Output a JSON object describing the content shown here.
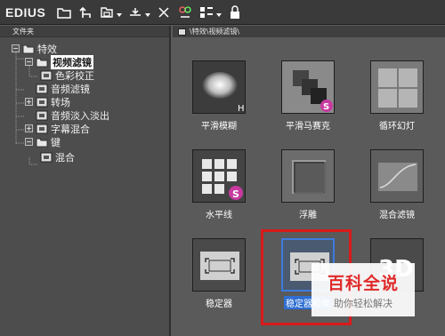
{
  "app": {
    "title": "EDIUS"
  },
  "toolbar": {
    "icons": [
      "folder-icon",
      "up-arrow-icon",
      "copy-folder-icon",
      "import-icon",
      "delete-icon",
      "properties-icon",
      "view-mode-icon",
      "lock-icon"
    ]
  },
  "left_pane": {
    "header": "文件夹",
    "tree": [
      {
        "label": "特效",
        "expander": "−",
        "icon": "folder-icon"
      },
      {
        "label": "视频滤镜",
        "expander": "−",
        "icon": "folder-icon",
        "selected": true
      },
      {
        "label": "色彩校正",
        "icon": "fx-icon"
      },
      {
        "label": "音频滤镜",
        "icon": "fx-icon"
      },
      {
        "label": "转场",
        "expander": "+",
        "icon": "fx-icon"
      },
      {
        "label": "音频淡入淡出",
        "icon": "fx-icon"
      },
      {
        "label": "字幕混合",
        "expander": "+",
        "icon": "fx-icon"
      },
      {
        "label": "键",
        "expander": "−",
        "icon": "folder-icon"
      },
      {
        "label": "混合",
        "icon": "fx-icon"
      }
    ]
  },
  "right_pane": {
    "path": "\\特效\\视频滤镜\\",
    "effects": [
      {
        "label": "平滑模糊",
        "icon": "smooth-blur-icon"
      },
      {
        "label": "平滑马赛克",
        "icon": "smooth-mosaic-icon"
      },
      {
        "label": "循环幻灯",
        "icon": "loop-slide-icon"
      },
      {
        "label": "水平线",
        "icon": "horizontal-lines-icon"
      },
      {
        "label": "浮雕",
        "icon": "emboss-icon"
      },
      {
        "label": "混合滤镜",
        "icon": "blend-filter-icon"
      },
      {
        "label": "稳定器",
        "icon": "stabilizer-icon"
      },
      {
        "label": "稳定器和果",
        "icon": "stabilizer-effect-icon",
        "selected": true
      },
      {
        "label": "",
        "icon": "3d-icon"
      }
    ]
  },
  "watermark": {
    "title": "百科全说",
    "subtitle": "助你轻松解决"
  }
}
